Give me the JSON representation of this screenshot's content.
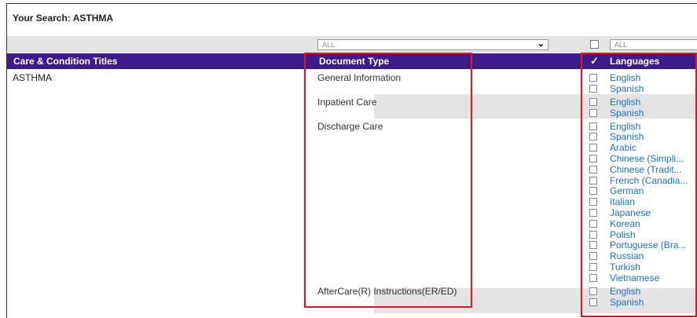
{
  "search": {
    "label": "Your Search:",
    "term": "ASTHMA"
  },
  "filters": {
    "document_type_value": "ALL",
    "language_value": "ALL"
  },
  "header": {
    "care_title": "Care & Condition Titles",
    "document_type": "Document Type",
    "check_mark": "✓",
    "languages": "Languages"
  },
  "condition": "ASTHMA",
  "documents": [
    {
      "type": "General Information",
      "languages": [
        "English",
        "Spanish"
      ]
    },
    {
      "type": "Inpatient Care",
      "languages": [
        "English",
        "Spanish"
      ]
    },
    {
      "type": "Discharge Care",
      "languages": [
        "English",
        "Spanish",
        "Arabic",
        "Chinese (Simpli...",
        "Chinese (Tradit...",
        "French (Canadia...",
        "German",
        "Italian",
        "Japanese",
        "Korean",
        "Polish",
        "Portuguese (Bra...",
        "Russian",
        "Turkish",
        "Vietnamese"
      ]
    },
    {
      "type": "AfterCare(R) Instructions(ER/ED)",
      "languages": [
        "English",
        "Spanish"
      ]
    }
  ],
  "colors": {
    "header_bg": "#3d1a8a",
    "link": "#1a73c8",
    "highlight": "#e8131b",
    "shade": "#e4e4e4"
  }
}
